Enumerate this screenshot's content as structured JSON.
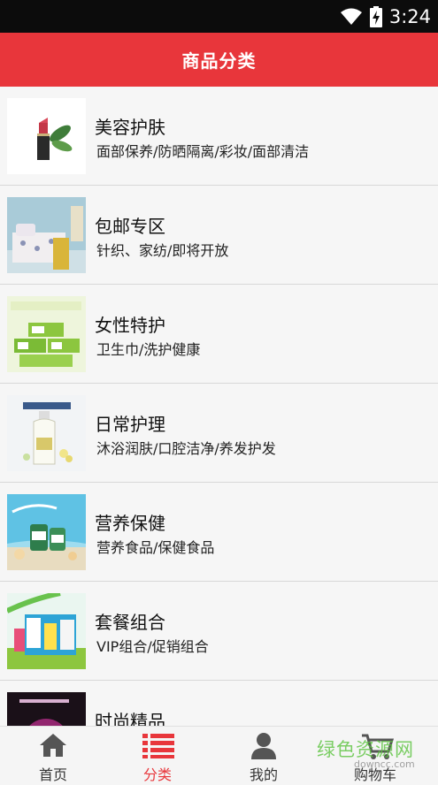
{
  "status_bar": {
    "time": "3:24",
    "wifi_icon": "wifi-icon",
    "battery_icon": "battery-charging-icon"
  },
  "header": {
    "title": "商品分类"
  },
  "categories": [
    {
      "title": "美容护肤",
      "subtitle": "面部保养/防晒隔离/彩妆/面部清洁",
      "image": "lipstick-image"
    },
    {
      "title": "包邮专区",
      "subtitle": "针织、家纺/即将开放",
      "image": "bedding-image"
    },
    {
      "title": "女性特护",
      "subtitle": "卫生巾/洗护健康",
      "image": "sanitary-pad-image"
    },
    {
      "title": "日常护理",
      "subtitle": "沐浴润肤/口腔洁净/养发护发",
      "image": "body-lotion-image"
    },
    {
      "title": "营养保健",
      "subtitle": "营养食品/保健食品",
      "image": "supplement-image"
    },
    {
      "title": "套餐组合",
      "subtitle": "VIP组合/促销组合",
      "image": "gift-set-image"
    },
    {
      "title": "时尚精品",
      "subtitle": "",
      "image": "fashion-image"
    }
  ],
  "tabbar": {
    "tabs": [
      {
        "label": "首页",
        "icon": "home-icon",
        "active": false
      },
      {
        "label": "分类",
        "icon": "list-icon",
        "active": true
      },
      {
        "label": "我的",
        "icon": "user-icon",
        "active": false
      },
      {
        "label": "购物车",
        "icon": "cart-icon",
        "active": false
      }
    ]
  },
  "watermark": {
    "text": "绿色资源网",
    "url": "downcc.com"
  },
  "colors": {
    "accent": "#e8363b",
    "status_bar": "#0c0c0c",
    "background": "#f4f4f4"
  }
}
